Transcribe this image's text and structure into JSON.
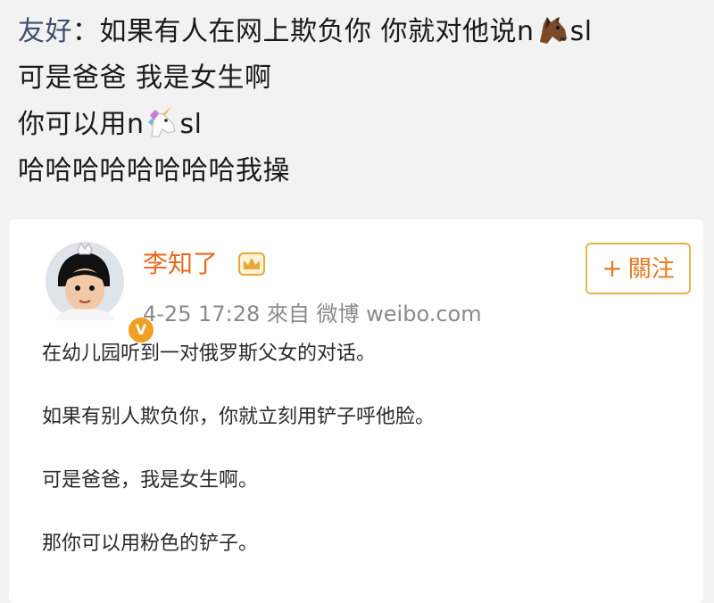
{
  "chat": {
    "line1_name": "友好",
    "line1_sep": "：",
    "line1_text": "如果有人在网上欺负你 你就对他说n",
    "line1_end": "sl",
    "line2": "可是爸爸 我是女生啊",
    "line3_text": "你可以用n",
    "line3_end": "sl",
    "line4": "哈哈哈哈哈哈哈哈我操",
    "emoji1": "horse-face-emoji",
    "emoji2": "unicorn-emoji"
  },
  "post": {
    "username": "李知了",
    "badge_icon": "crown-icon",
    "verified_icon": "v-badge-icon",
    "meta": "4-25 17:28  來自 微博 weibo.com",
    "follow_plus": "+",
    "follow_label": "關注",
    "paragraphs": [
      "在幼儿园听到一对俄罗斯父女的对话。",
      "如果有别人欺负你，你就立刻用铲子呼他脸。",
      "可是爸爸，我是女生啊。",
      "那你可以用粉色的铲子。"
    ],
    "accent_color": "#e86a1e"
  }
}
